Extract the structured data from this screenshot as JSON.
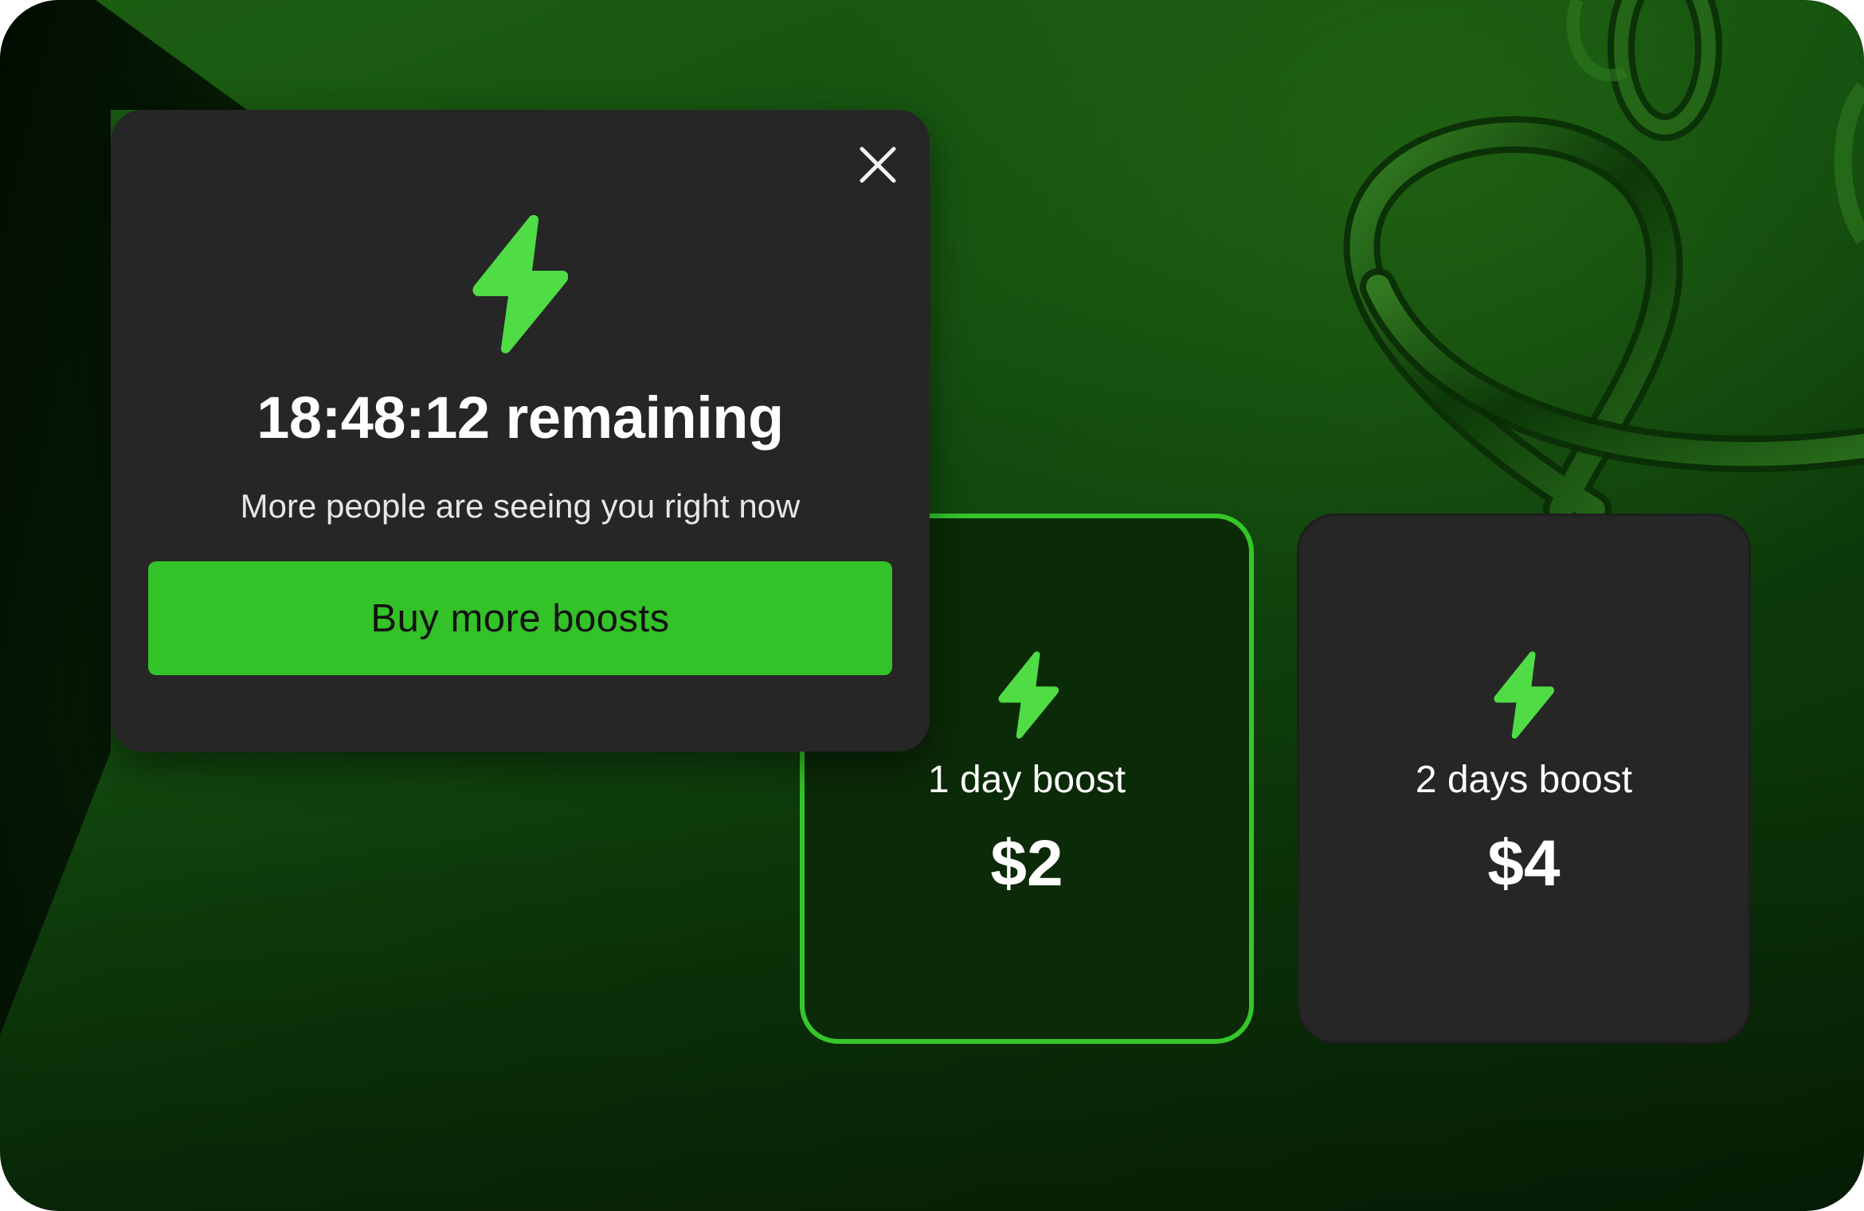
{
  "popup": {
    "close_icon": "close-icon",
    "boost_icon": "lightning-bolt-icon",
    "title": "18:48:12 remaining",
    "subtitle": "More people are seeing you right now",
    "buy_button_label": "Buy more boosts"
  },
  "plans": [
    {
      "label": "1 day boost",
      "price": "$2",
      "selected": true,
      "icon": "lightning-bolt-icon"
    },
    {
      "label": "2 days boost",
      "price": "$4",
      "selected": false,
      "icon": "lightning-bolt-icon"
    }
  ],
  "colors": {
    "accent": "#33c227",
    "bolt": "#4fdc45",
    "panel": "#262626",
    "background": "#145010",
    "selected_card": "#0b2a07"
  }
}
